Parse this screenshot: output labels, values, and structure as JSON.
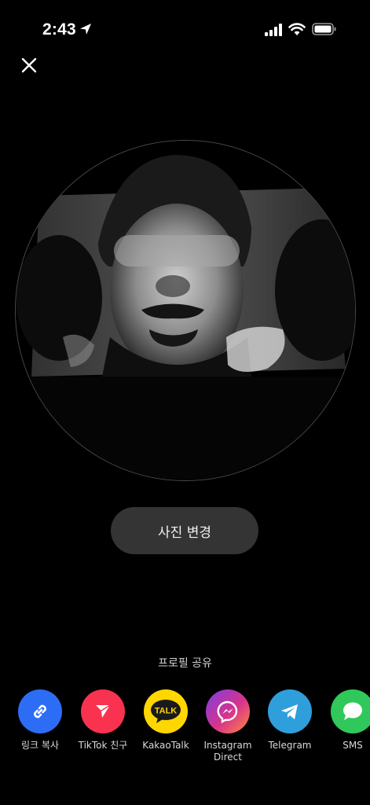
{
  "status_bar": {
    "time": "2:43"
  },
  "main": {
    "change_photo_label": "사진 변경",
    "share_title": "프로필 공유"
  },
  "share_options": [
    {
      "label": "링크 복사",
      "icon": "link-icon",
      "color": "#2d6df6"
    },
    {
      "label": "TikTok 친구",
      "icon": "send-icon",
      "color": "#f8324f"
    },
    {
      "label": "KakaoTalk",
      "icon": "kakaotalk-icon",
      "color": "#ffd700",
      "badge": "TALK"
    },
    {
      "label_line1": "Instagram",
      "label_line2": "Direct",
      "icon": "messenger-icon",
      "color": "#d8338b"
    },
    {
      "label": "Telegram",
      "icon": "telegram-icon",
      "color": "#2f9fdb"
    },
    {
      "label": "SMS",
      "icon": "message-icon",
      "color": "#30c85a"
    }
  ]
}
